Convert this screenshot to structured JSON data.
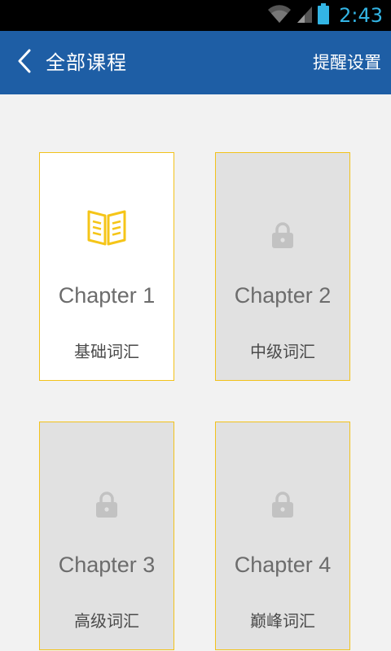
{
  "status_bar": {
    "time": "2:43",
    "clock_color": "#33b5e5",
    "icons": [
      "wifi-icon",
      "signal-icon",
      "battery-icon"
    ]
  },
  "app_bar": {
    "title": "全部课程",
    "action_label": "提醒设置",
    "back_icon": "chevron-left-icon",
    "background": "#1e5ea5"
  },
  "colors": {
    "card_border": "#f2c21b",
    "locked_background": "#e1e1e1",
    "unlocked_background": "#ffffff",
    "book_icon": "#f5c518",
    "lock_icon": "#c2c2c2"
  },
  "chapters": [
    {
      "title": "Chapter 1",
      "subtitle": "基础词汇",
      "locked": false,
      "icon": "book-icon"
    },
    {
      "title": "Chapter 2",
      "subtitle": "中级词汇",
      "locked": true,
      "icon": "lock-icon"
    },
    {
      "title": "Chapter 3",
      "subtitle": "高级词汇",
      "locked": true,
      "icon": "lock-icon"
    },
    {
      "title": "Chapter 4",
      "subtitle": "巅峰词汇",
      "locked": true,
      "icon": "lock-icon"
    }
  ]
}
